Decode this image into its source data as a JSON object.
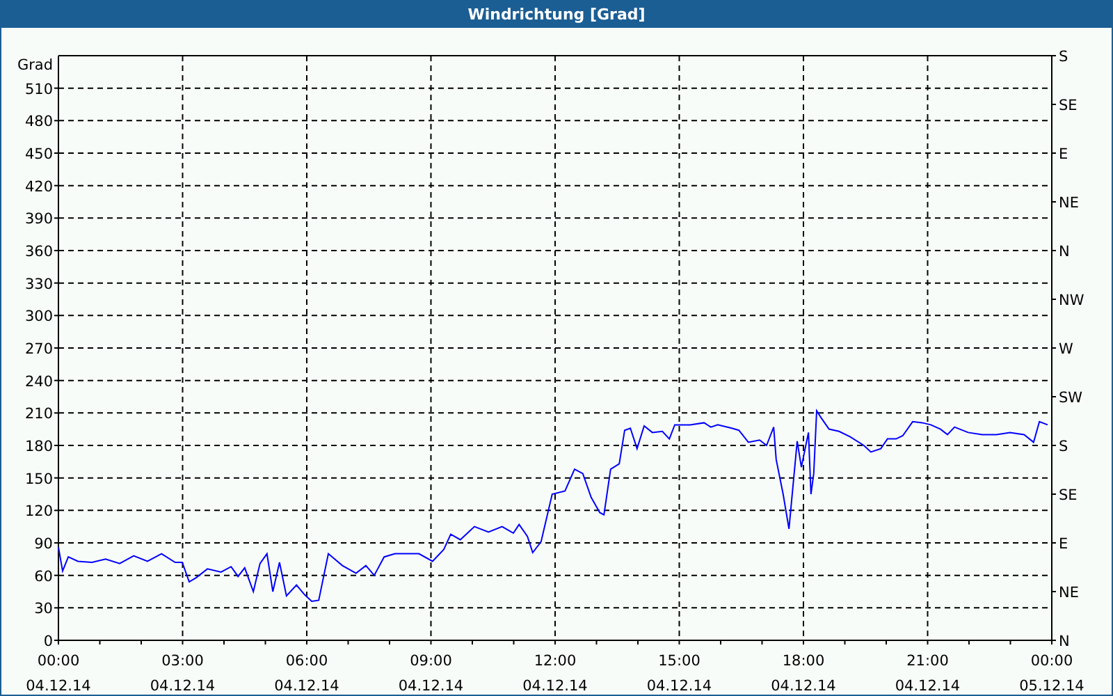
{
  "window": {
    "title": "Windrichtung [Grad]"
  },
  "chart": {
    "chart_data": {
      "type": "line",
      "ylabel": "Grad",
      "grid": true,
      "xlim": [
        0,
        24
      ],
      "ylim": [
        0,
        540
      ],
      "x": [
        0,
        0.1,
        0.24,
        0.47,
        0.81,
        1.14,
        1.48,
        1.82,
        2.15,
        2.49,
        2.82,
        2.99,
        3.16,
        3.33,
        3.6,
        3.93,
        4.17,
        4.34,
        4.5,
        4.71,
        4.87,
        5.04,
        5.18,
        5.34,
        5.51,
        5.75,
        5.95,
        6.12,
        6.29,
        6.52,
        6.86,
        7.19,
        7.43,
        7.63,
        7.87,
        8.13,
        8.71,
        9.04,
        9.31,
        9.48,
        9.71,
        10.05,
        10.39,
        10.72,
        10.99,
        11.13,
        11.33,
        11.46,
        11.66,
        11.93,
        12.24,
        12.47,
        12.67,
        12.87,
        13.08,
        13.18,
        13.34,
        13.55,
        13.68,
        13.82,
        13.98,
        14.15,
        14.35,
        14.59,
        14.76,
        14.89,
        15.26,
        15.6,
        15.76,
        15.93,
        16.27,
        16.44,
        16.67,
        16.94,
        17.11,
        17.28,
        17.34,
        17.51,
        17.65,
        17.85,
        17.95,
        18.12,
        18.18,
        18.25,
        18.32,
        18.42,
        18.62,
        18.86,
        19.13,
        19.46,
        19.63,
        19.87,
        20.03,
        20.24,
        20.4,
        20.64,
        20.87,
        21.08,
        21.31,
        21.48,
        21.65,
        21.98,
        22.32,
        22.66,
        22.99,
        23.33,
        23.56,
        23.7,
        23.9
      ],
      "series": [
        {
          "color": "#0000ff",
          "values": [
            86,
            64,
            77,
            73,
            72,
            75,
            71,
            78,
            73,
            80,
            72,
            72,
            54,
            58,
            66,
            63,
            68,
            59,
            67,
            45,
            71,
            80,
            45,
            72,
            41,
            51,
            42,
            36,
            37,
            80,
            69,
            62,
            69,
            60,
            77,
            80,
            80,
            73,
            84,
            98,
            93,
            105,
            100,
            105,
            99,
            107,
            96,
            81,
            91,
            135,
            138,
            158,
            154,
            132,
            118,
            116,
            158,
            163,
            194,
            196,
            177,
            198,
            192,
            193,
            186,
            199,
            199,
            201,
            197,
            199,
            196,
            194,
            183,
            185,
            180,
            197,
            167,
            135,
            103,
            184,
            160,
            192,
            135,
            154,
            212,
            206,
            195,
            193,
            188,
            180,
            174,
            177,
            186,
            186,
            189,
            202,
            201,
            199,
            195,
            190,
            197,
            192,
            190,
            190,
            192,
            190,
            183,
            202,
            199
          ]
        }
      ],
      "yticks": [
        0,
        30,
        60,
        90,
        120,
        150,
        180,
        210,
        240,
        270,
        300,
        330,
        360,
        390,
        420,
        450,
        480,
        510
      ],
      "xticks": [
        {
          "value": 0,
          "label": "00:00"
        },
        {
          "value": 3,
          "label": "03:00"
        },
        {
          "value": 6,
          "label": "06:00"
        },
        {
          "value": 9,
          "label": "09:00"
        },
        {
          "value": 12,
          "label": "12:00"
        },
        {
          "value": 15,
          "label": "15:00"
        },
        {
          "value": 18,
          "label": "18:00"
        },
        {
          "value": 21,
          "label": "21:00"
        },
        {
          "value": 24,
          "label": "00:00"
        }
      ]
    },
    "x_dates": [
      "04.12.14",
      "04.12.14",
      "04.12.14",
      "04.12.14",
      "04.12.14",
      "04.12.14",
      "04.12.14",
      "04.12.14",
      "05.12.14"
    ],
    "compass_axis": [
      "S",
      "SE",
      "E",
      "NE",
      "N",
      "NW",
      "W",
      "SW",
      "S",
      "SE",
      "E",
      "NE",
      "N"
    ]
  }
}
